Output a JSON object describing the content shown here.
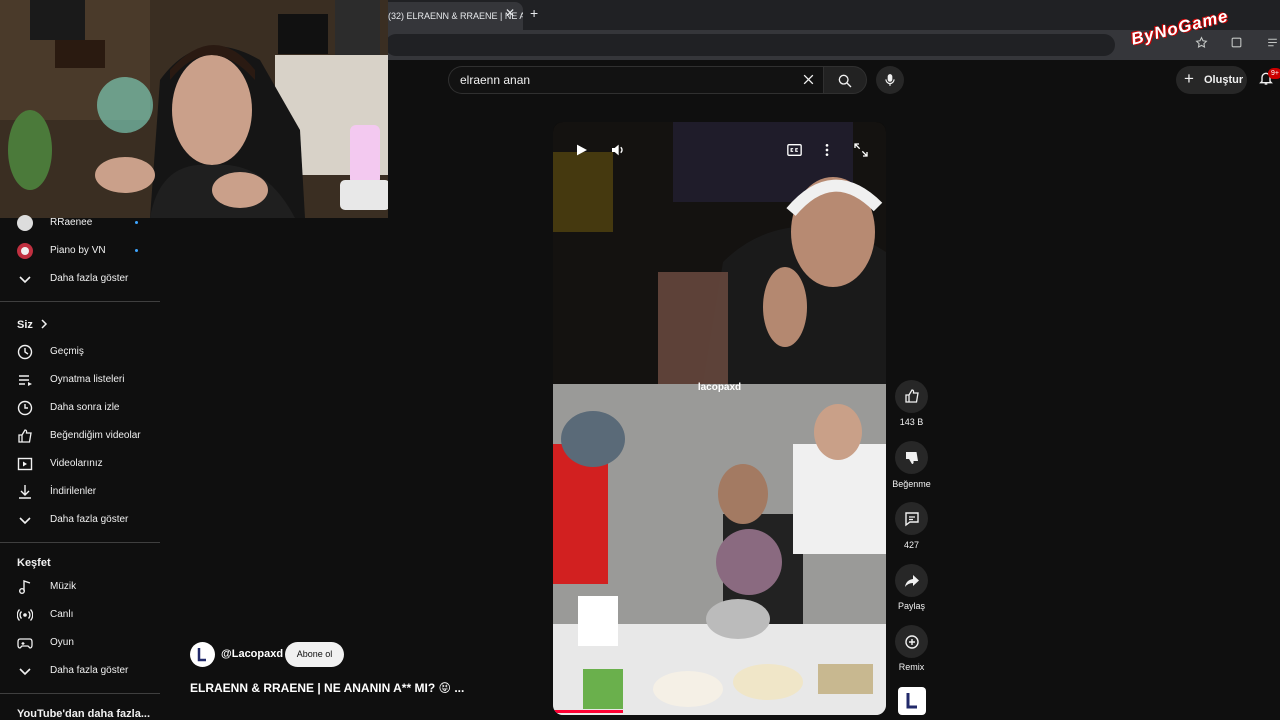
{
  "browser": {
    "tab_title": "(32) ELRAENN & RRAENE | NE A",
    "tab_close": "✕",
    "new_tab": "+"
  },
  "watermark": "ByNoGame",
  "header": {
    "search_value": "elraenn anan",
    "create_label": "Oluştur",
    "notification_count": "9+"
  },
  "sidebar": {
    "subscriptions": [
      {
        "label": "RRaenee",
        "icon": "channel-avatar"
      },
      {
        "label": "Piano by VN",
        "icon": "channel-avatar"
      },
      {
        "label": "Daha fazla göster",
        "icon": "chevron-down-icon"
      }
    ],
    "you_heading": "Siz",
    "you_items": [
      {
        "label": "Geçmiş",
        "icon": "history-icon"
      },
      {
        "label": "Oynatma listeleri",
        "icon": "playlist-icon"
      },
      {
        "label": "Daha sonra izle",
        "icon": "clock-icon"
      },
      {
        "label": "Beğendiğim videolar",
        "icon": "thumbs-up-icon"
      },
      {
        "label": "Videolarınız",
        "icon": "video-icon"
      },
      {
        "label": "İndirilenler",
        "icon": "download-icon"
      },
      {
        "label": "Daha fazla göster",
        "icon": "chevron-down-icon"
      }
    ],
    "explore_heading": "Keşfet",
    "explore_items": [
      {
        "label": "Müzik",
        "icon": "music-icon"
      },
      {
        "label": "Canlı",
        "icon": "live-icon"
      },
      {
        "label": "Oyun",
        "icon": "gamepad-icon"
      },
      {
        "label": "Daha fazla göster",
        "icon": "chevron-down-icon"
      }
    ],
    "more_from_youtube": "YouTube'dan daha fazla..."
  },
  "short": {
    "overlay_handle": "lacopaxd",
    "like_count": "143 B",
    "dislike_label": "Beğenme",
    "comment_count": "427",
    "share_label": "Paylaş",
    "remix_label": "Remix",
    "progress": 0.21,
    "channel_handle": "@Lacopaxd",
    "subscribe_label": "Abone ol",
    "title": "ELRAENN & RRAENE | NE ANANIN A** MI? 😝 ..."
  },
  "colors": {
    "background": "#0f0f0f",
    "accent_red": "#ff0033",
    "subscription_dot": "#3ea6ff"
  }
}
